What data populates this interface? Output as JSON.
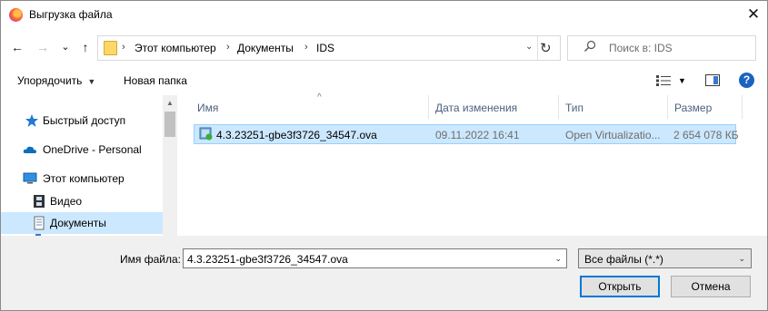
{
  "window": {
    "title": "Выгрузка файла",
    "close_glyph": "✕"
  },
  "nav": {
    "back_glyph": "←",
    "forward_glyph": "→",
    "recent_glyph": "⌄",
    "up_glyph": "↑"
  },
  "address": {
    "breadcrumbs": [
      "Этот компьютер",
      "Документы",
      "IDS"
    ],
    "separator": "›",
    "dropdown_glyph": "⌄",
    "refresh_glyph": "↻"
  },
  "search": {
    "placeholder": "Поиск в: IDS"
  },
  "toolbar": {
    "organize_label": "Упорядочить",
    "caret": "▼",
    "new_folder_label": "Новая папка",
    "help_glyph": "?"
  },
  "sidebar": {
    "items": [
      {
        "label": "Быстрый доступ",
        "icon": "star-icon"
      },
      {
        "label": "OneDrive - Personal",
        "icon": "cloud-icon"
      },
      {
        "label": "Этот компьютер",
        "icon": "computer-icon"
      },
      {
        "label": "Видео",
        "icon": "video-folder-icon"
      },
      {
        "label": "Документы",
        "icon": "documents-folder-icon",
        "selected": true
      }
    ]
  },
  "files": {
    "columns": [
      "Имя",
      "Дата изменения",
      "Тип",
      "Размер"
    ],
    "sort_glyph": "^",
    "rows": [
      {
        "name": "4.3.23251-gbe3f3726_34547.ova",
        "date": "09.11.2022 16:41",
        "type": "Open Virtualizatio...",
        "size": "2 654 078 КБ",
        "icon": "ova-file-icon",
        "selected": true
      }
    ]
  },
  "footer": {
    "filename_label": "Имя файла:",
    "filename_value": "4.3.23251-gbe3f3726_34547.ova",
    "filter_value": "Все файлы (*.*)",
    "dd_glyph": "⌄",
    "open_label": "Открыть",
    "cancel_label": "Отмена"
  },
  "colors": {
    "selection": "#cce8ff",
    "accent": "#0078d7",
    "header_text": "#4d6082"
  }
}
